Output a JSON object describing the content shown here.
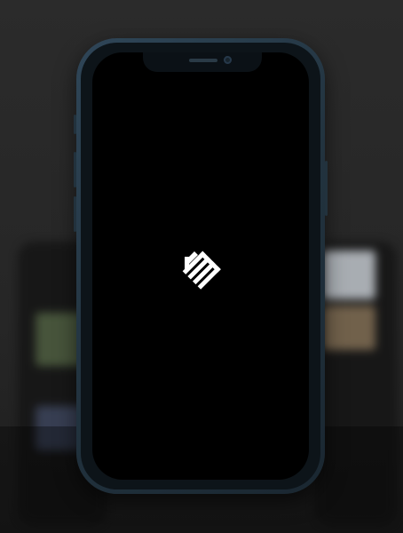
{
  "splash": {
    "logo_icon": "house-stairs-logo-icon",
    "background_color": "#000000",
    "logo_color": "#ffffff"
  },
  "device": {
    "model": "smartphone",
    "frame_color": "#2f4658"
  }
}
